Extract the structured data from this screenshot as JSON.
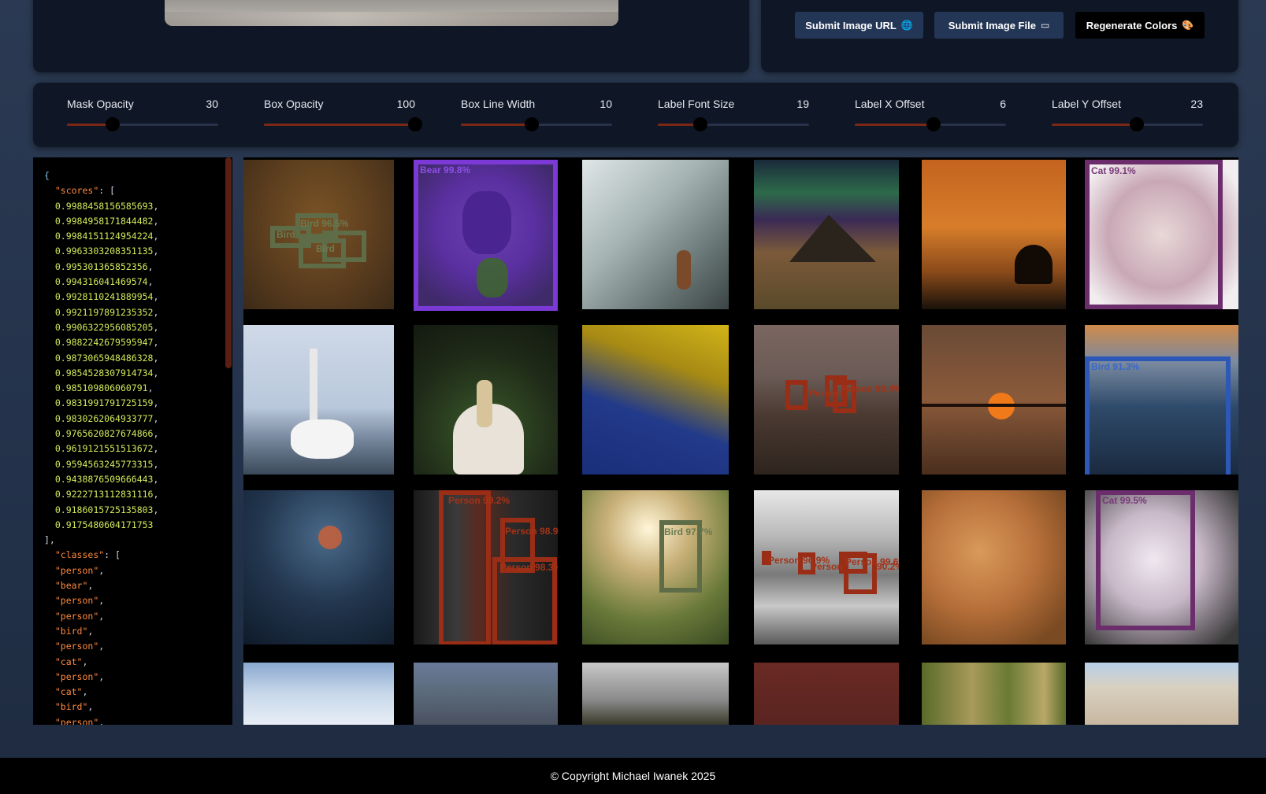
{
  "buttons": {
    "url_label": "Submit Image URL",
    "file_label": "Submit Image File",
    "colors_label": "Regenerate Colors"
  },
  "icons": {
    "url": "globe-icon",
    "file": "framed-picture-icon",
    "colors": "palette-icon"
  },
  "sliders": [
    {
      "label": "Mask Opacity",
      "value": "30",
      "fraction": 0.3
    },
    {
      "label": "Box Opacity",
      "value": "100",
      "fraction": 1.0
    },
    {
      "label": "Box Line Width",
      "value": "10",
      "fraction": 0.47
    },
    {
      "label": "Label Font Size",
      "value": "19",
      "fraction": 0.28
    },
    {
      "label": "Label X Offset",
      "value": "6",
      "fraction": 0.52
    },
    {
      "label": "Label Y Offset",
      "value": "23",
      "fraction": 0.56
    }
  ],
  "colors": {
    "accent": "#7a2716",
    "button_bg": "#243656",
    "panel_bg": "#0f1726",
    "page_bg": "#2b3a52",
    "json_key": "#ff8a3d",
    "json_number": "#d4ea5a",
    "json_brace": "#7ec7e8"
  },
  "json_view": {
    "open_brace": "{",
    "scores_key": "\"scores\"",
    "scores": [
      "0.9988458156585693",
      "0.9984958171844482",
      "0.9984151124954224",
      "0.9963303208351135",
      "0.995301365852356",
      "0.994316041469574",
      "0.9928110241889954",
      "0.9921197891235352",
      "0.9906322956085205",
      "0.9882242679595947",
      "0.9873065948486328",
      "0.9854528307914734",
      "0.985109806060791",
      "0.9831991791725159",
      "0.9830262064933777",
      "0.9765620827674866",
      "0.9619121551513672",
      "0.9594563245773315",
      "0.9438876509666443",
      "0.9222713112831116",
      "0.9186015725135803",
      "0.9175480604171753"
    ],
    "classes_key": "\"classes\"",
    "classes": [
      "\"person\"",
      "\"bear\"",
      "\"person\"",
      "\"person\"",
      "\"bird\"",
      "\"person\"",
      "\"cat\"",
      "\"person\"",
      "\"cat\"",
      "\"bird\"",
      "\"person\""
    ]
  },
  "detections": {
    "bear": "Bear 99.8%",
    "fox_cat": "Cat 99.1%",
    "bird_group": "Bird 96.5%",
    "bird_group_2": "Bird",
    "bird_group_3": "Bird",
    "rock_bird": "Bird 91.3%",
    "women_1": "Person 99.2%",
    "women_2": "Person 98.9%",
    "women_3": "Person 98.3%",
    "plant_bird": "Bird 97.7%",
    "cat": "Cat 99.5%",
    "beach_person_1": "Person",
    "beach_person_2": "Person",
    "beach_person_3": "Person 99.4%",
    "bw_person_1": "Person 96.9%",
    "bw_person_2": "Person",
    "bw_person_3": "Person 99.6%",
    "bw_person_4": "90.2%"
  },
  "footer": "© Copyright Michael Iwanek 2025"
}
